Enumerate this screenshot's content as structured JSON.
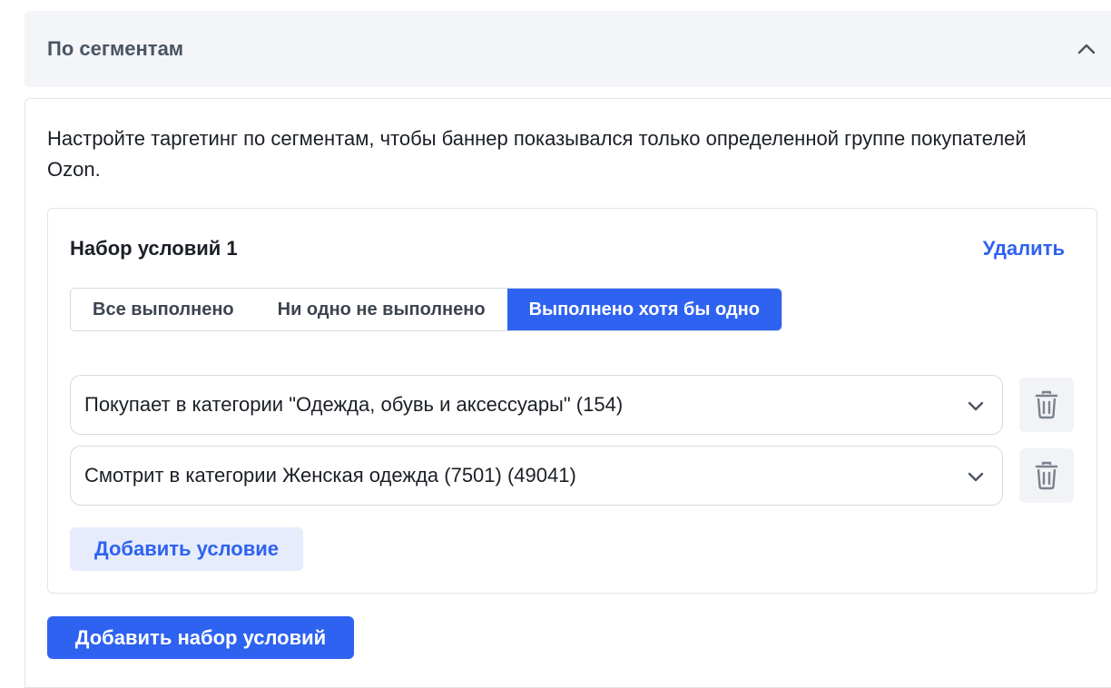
{
  "accordion": {
    "title": "По сегментам",
    "toggle_icon": "chevron-up-icon"
  },
  "intro_text": "Настройте таргетинг по сегментам, чтобы баннер показывался только определенной группе покупателей Ozon.",
  "condition_set": {
    "title": "Набор условий 1",
    "delete_label": "Удалить",
    "modes": [
      {
        "label": "Все выполнено",
        "selected": false
      },
      {
        "label": "Ни одно не выполнено",
        "selected": false
      },
      {
        "label": "Выполнено хотя бы одно",
        "selected": true
      }
    ],
    "conditions": [
      {
        "value": "Покупает в категории \"Одежда, обувь и аксессуары\" (154)"
      },
      {
        "value": "Смотрит в категории Женская одежда (7501) (49041)"
      }
    ],
    "add_condition_label": "Добавить условие"
  },
  "add_set_label": "Добавить набор условий",
  "colors": {
    "accent": "#2e62f0",
    "accent_light": "#e6ecfb",
    "header_bg": "#f3f5f8",
    "border": "#d6dae2"
  }
}
